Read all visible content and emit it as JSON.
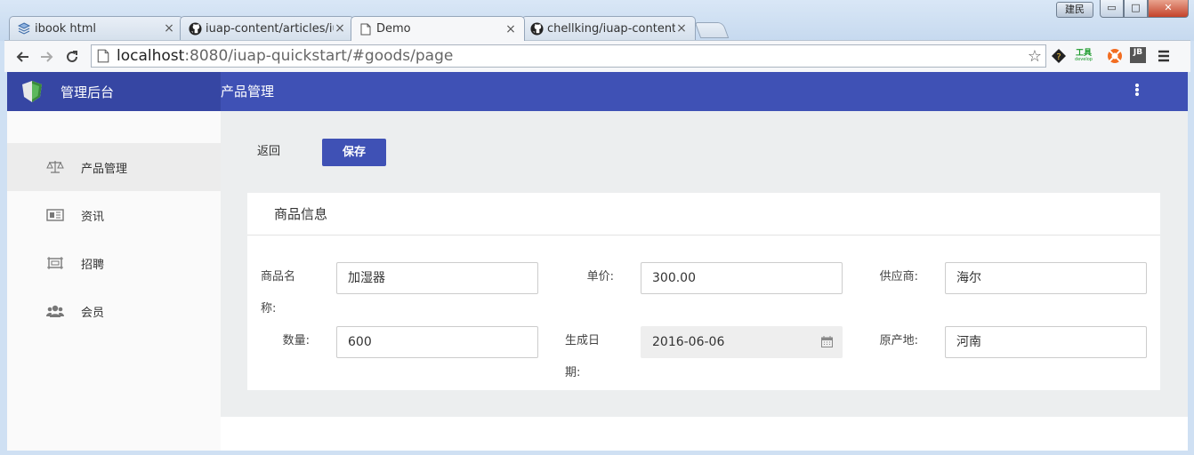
{
  "window": {
    "user_badge": "建民",
    "minimize": "▭",
    "maximize": "□",
    "close": "✕"
  },
  "tabs": [
    {
      "label": "ibook html",
      "icon": "book-icon"
    },
    {
      "label": "iuap-content/articles/iu",
      "icon": "github-icon"
    },
    {
      "label": "Demo",
      "icon": "page-icon",
      "active": true
    },
    {
      "label": "chellking/iuap-content",
      "icon": "github-icon"
    }
  ],
  "address": {
    "host": "localhost",
    "rest": ":8080/iuap-quickstart/#goods/page"
  },
  "extensions": {
    "tools_label": "工具",
    "tools_sub": "develop",
    "jb_label": "JB"
  },
  "app": {
    "brand": "管理后台",
    "page_title": "产品管理"
  },
  "sidebar": {
    "items": [
      {
        "label": "产品管理",
        "icon": "scale-icon",
        "active": true
      },
      {
        "label": "资讯",
        "icon": "newspaper-icon"
      },
      {
        "label": "招聘",
        "icon": "frame-icon"
      },
      {
        "label": "会员",
        "icon": "users-icon"
      }
    ]
  },
  "actions": {
    "back": "返回",
    "save": "保存"
  },
  "form": {
    "title": "商品信息",
    "name_label_1": "商品名",
    "name_label_2": "称:",
    "name_value": "加湿器",
    "price_label": "单价:",
    "price_value": "300.00",
    "supplier_label": "供应商:",
    "supplier_value": "海尔",
    "qty_label": "数量:",
    "qty_value": "600",
    "date_label_1": "生成日",
    "date_label_2": "期:",
    "date_value": "2016-06-06",
    "origin_label": "原产地:",
    "origin_value": "河南"
  },
  "colors": {
    "primary": "#3f51b5",
    "brand_bg": "#3646a3",
    "content_bg": "#eceeef"
  }
}
